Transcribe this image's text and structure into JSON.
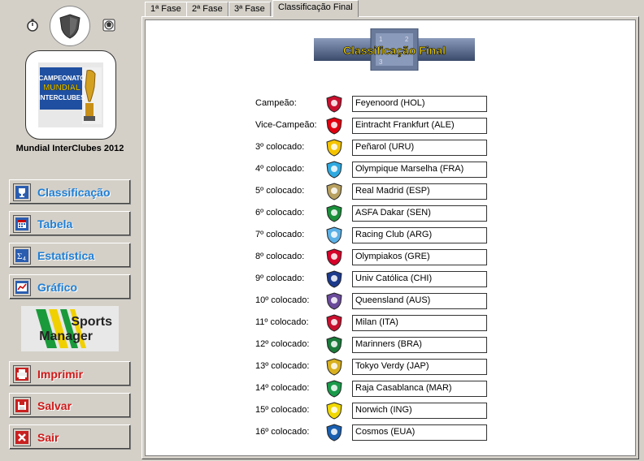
{
  "sidebar": {
    "championship_name": "Mundial InterClubes 2012",
    "champ_logo_text": [
      "CAMPEONATO",
      "MUNDIAL",
      "INTERCLUBES"
    ],
    "nav": [
      {
        "label": "Classificação",
        "icon": "trophy-icon"
      },
      {
        "label": "Tabela",
        "icon": "calendar-icon"
      },
      {
        "label": "Estatística",
        "icon": "sigma-icon"
      },
      {
        "label": "Gráfico",
        "icon": "chart-icon"
      }
    ],
    "sports_manager": [
      "Sports",
      "Manager"
    ],
    "actions": [
      {
        "label": "Imprimir",
        "icon": "printer-icon"
      },
      {
        "label": "Salvar",
        "icon": "save-icon"
      },
      {
        "label": "Sair",
        "icon": "close-icon"
      }
    ]
  },
  "tabs": [
    "1ª Fase",
    "2ª Fase",
    "3ª Fase",
    "Classificação Final"
  ],
  "active_tab": 3,
  "banner": {
    "title": "Classificação Final",
    "digits": [
      "1",
      "2",
      "3"
    ]
  },
  "standings": [
    {
      "pos": "Campeão:",
      "team": "Feyenoord (HOL)",
      "color": "#c8102e"
    },
    {
      "pos": "Vice-Campeão:",
      "team": "Eintracht Frankfurt (ALE)",
      "color": "#e1000f"
    },
    {
      "pos": "3º colocado:",
      "team": "Peñarol (URU)",
      "color": "#f5c400"
    },
    {
      "pos": "4º colocado:",
      "team": "Olympique Marselha (FRA)",
      "color": "#2fa9e0"
    },
    {
      "pos": "5º colocado:",
      "team": "Real Madrid (ESP)",
      "color": "#b8a060"
    },
    {
      "pos": "6º colocado:",
      "team": "ASFA Dakar (SEN)",
      "color": "#1a8f3a"
    },
    {
      "pos": "7º colocado:",
      "team": "Racing Club (ARG)",
      "color": "#5bb0e6"
    },
    {
      "pos": "8º colocado:",
      "team": "Olympiakos (GRE)",
      "color": "#d6002a"
    },
    {
      "pos": "9º colocado:",
      "team": "Univ Católica (CHI)",
      "color": "#1c3a8c"
    },
    {
      "pos": "10º colocado:",
      "team": "Queensland (AUS)",
      "color": "#6a4a9a"
    },
    {
      "pos": "11º colocado:",
      "team": "Milan (ITA)",
      "color": "#c8102e"
    },
    {
      "pos": "12º colocado:",
      "team": "Marinners (BRA)",
      "color": "#1a7a3a"
    },
    {
      "pos": "13º colocado:",
      "team": "Tokyo Verdy (JAP)",
      "color": "#d8b020"
    },
    {
      "pos": "14º colocado:",
      "team": "Raja Casablanca (MAR)",
      "color": "#1a9a4a"
    },
    {
      "pos": "15º colocado:",
      "team": "Norwich (ING)",
      "color": "#f0d800"
    },
    {
      "pos": "16º colocado:",
      "team": "Cosmos (EUA)",
      "color": "#1a5fb0"
    }
  ]
}
